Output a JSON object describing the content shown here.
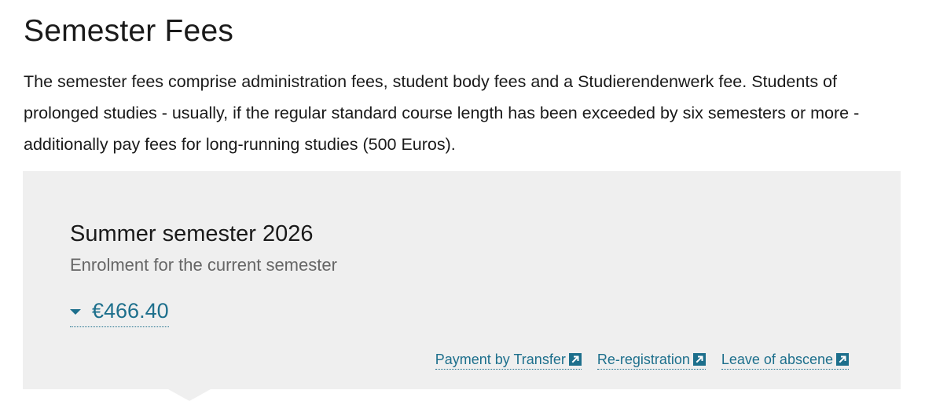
{
  "page": {
    "title": "Semester Fees",
    "intro": "The semester fees comprise administration fees, student body fees and a Studierendenwerk fee. Students of prolonged studies - usually, if the regular standard course length has been exceeded by six semesters or more - additionally pay fees for long-running studies (500 Euros)."
  },
  "fee_box": {
    "title": "Summer semester 2026",
    "subtitle": "Enrolment for the current semester",
    "amount": "€466.40",
    "amount_icon": "caret-down-icon",
    "links": [
      {
        "label": "Payment by Transfer",
        "icon": "external-link-icon"
      },
      {
        "label": "Re-registration",
        "icon": "external-link-icon"
      },
      {
        "label": "Leave of abscene",
        "icon": "external-link-icon"
      }
    ]
  },
  "colors": {
    "text": "#1a1a1a",
    "muted": "#666666",
    "link": "#1d6f8c",
    "panel": "#efefef"
  }
}
